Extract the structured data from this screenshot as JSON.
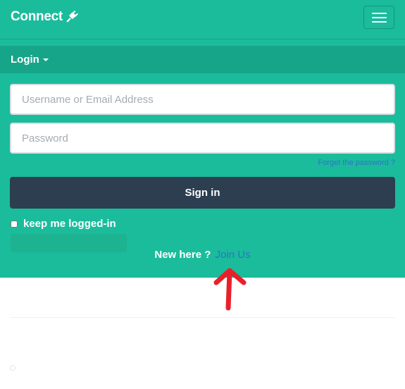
{
  "navbar": {
    "brand": "Connect",
    "brand_icon": "plug-icon",
    "menu_icon": "hamburger-menu-icon"
  },
  "login_panel": {
    "dropdown_label": "Login",
    "username_placeholder": "Username or Email Address",
    "password_placeholder": "Password",
    "forgot_link": "Forget the password ?",
    "signin_label": "Sign in",
    "keep_logged_in_label": "keep me logged-in",
    "new_here_text": "New here ?",
    "join_link": "Join Us"
  },
  "annotation": {
    "arrow_icon": "red-arrow-up-icon",
    "arrow_color": "#e8202a"
  },
  "colors": {
    "primary": "#1abc9c",
    "primary_dark": "#17a589",
    "button_dark": "#2c3e50",
    "link": "#2f74c4"
  }
}
